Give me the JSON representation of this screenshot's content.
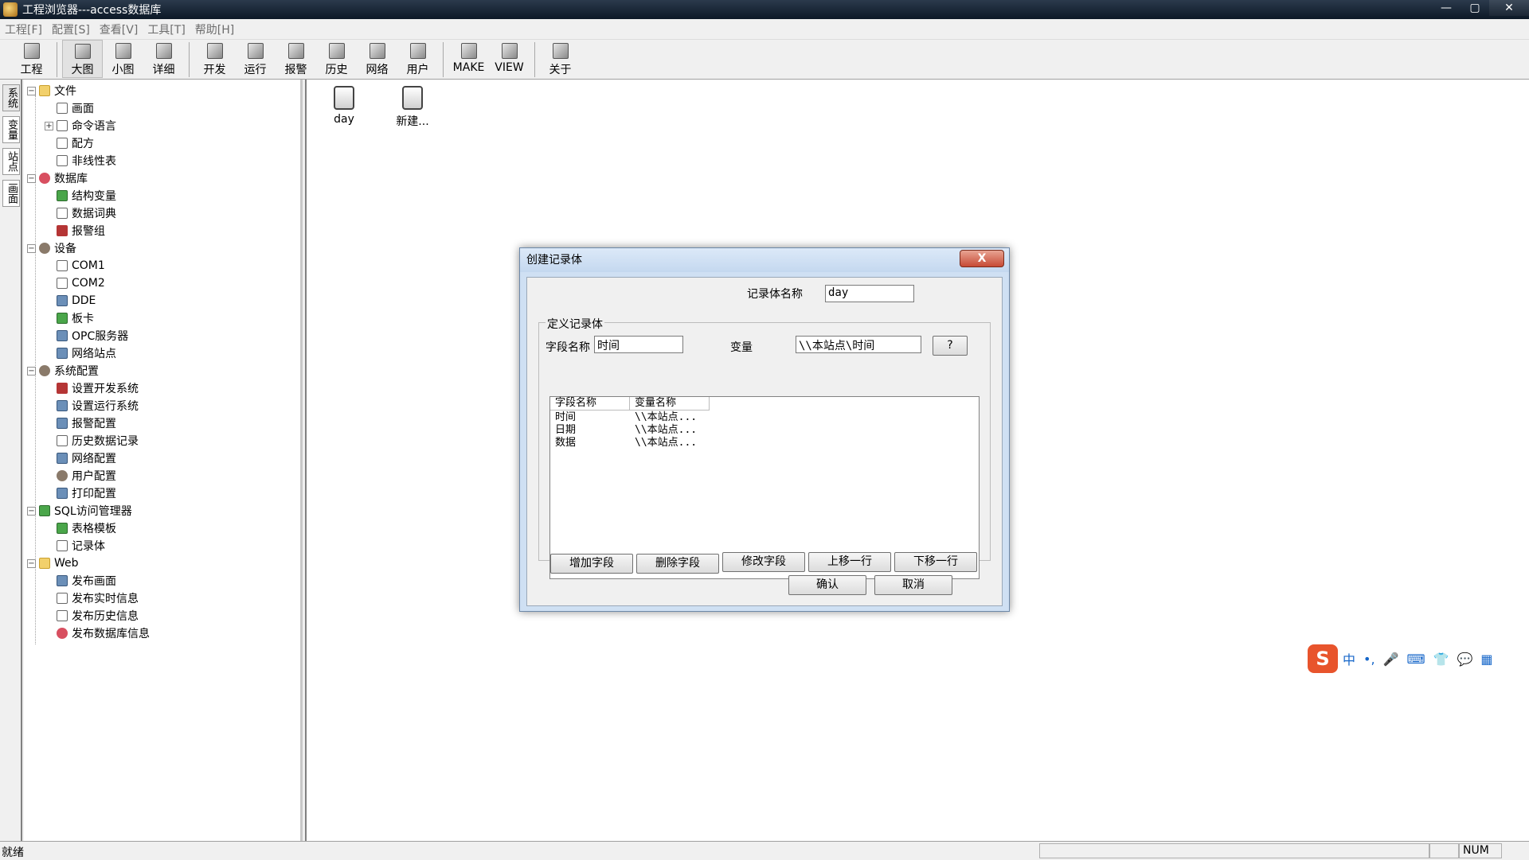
{
  "window": {
    "title": "工程浏览器---access数据库",
    "minimize": "—",
    "maximize": "▢",
    "close": "✕"
  },
  "menubar": [
    "工程[F]",
    "配置[S]",
    "查看[V]",
    "工具[T]",
    "帮助[H]"
  ],
  "toolbar": [
    "工程",
    "大图",
    "小图",
    "详细",
    "开发",
    "运行",
    "报警",
    "历史",
    "网络",
    "用户",
    "MAKE",
    "VIEW",
    "关于"
  ],
  "sidetabs": [
    "系统",
    "变量",
    "站点",
    "画面"
  ],
  "tree": [
    {
      "label": "文件",
      "level": 0,
      "exp": "−",
      "icon": "folder"
    },
    {
      "label": "画面",
      "level": 1,
      "icon": "doc"
    },
    {
      "label": "命令语言",
      "level": 1,
      "exp": "+",
      "icon": "doc"
    },
    {
      "label": "配方",
      "level": 1,
      "icon": "doc"
    },
    {
      "label": "非线性表",
      "level": 1,
      "icon": "doc"
    },
    {
      "label": "数据库",
      "level": 0,
      "exp": "−",
      "icon": "db"
    },
    {
      "label": "结构变量",
      "level": 1,
      "icon": "green"
    },
    {
      "label": "数据词典",
      "level": 1,
      "icon": "doc"
    },
    {
      "label": "报警组",
      "level": 1,
      "icon": "red"
    },
    {
      "label": "设备",
      "level": 0,
      "exp": "−",
      "icon": "gear"
    },
    {
      "label": "COM1",
      "level": 1,
      "icon": "doc"
    },
    {
      "label": "COM2",
      "level": 1,
      "icon": "doc"
    },
    {
      "label": "DDE",
      "level": 1,
      "icon": "pc"
    },
    {
      "label": "板卡",
      "level": 1,
      "icon": "green"
    },
    {
      "label": "OPC服务器",
      "level": 1,
      "icon": "pc"
    },
    {
      "label": "网络站点",
      "level": 1,
      "icon": "pc"
    },
    {
      "label": "系统配置",
      "level": 0,
      "exp": "−",
      "icon": "gear"
    },
    {
      "label": "设置开发系统",
      "level": 1,
      "icon": "red"
    },
    {
      "label": "设置运行系统",
      "level": 1,
      "icon": "pc"
    },
    {
      "label": "报警配置",
      "level": 1,
      "icon": "pc"
    },
    {
      "label": "历史数据记录",
      "level": 1,
      "icon": "doc"
    },
    {
      "label": "网络配置",
      "level": 1,
      "icon": "pc"
    },
    {
      "label": "用户配置",
      "level": 1,
      "icon": "gear"
    },
    {
      "label": "打印配置",
      "level": 1,
      "icon": "pc"
    },
    {
      "label": "SQL访问管理器",
      "level": 0,
      "exp": "−",
      "icon": "green"
    },
    {
      "label": "表格模板",
      "level": 1,
      "icon": "green"
    },
    {
      "label": "记录体",
      "level": 1,
      "icon": "doc"
    },
    {
      "label": "Web",
      "level": 0,
      "exp": "−",
      "icon": "folder"
    },
    {
      "label": "发布画面",
      "level": 1,
      "icon": "pc"
    },
    {
      "label": "发布实时信息",
      "level": 1,
      "icon": "doc"
    },
    {
      "label": "发布历史信息",
      "level": 1,
      "icon": "doc"
    },
    {
      "label": "发布数据库信息",
      "level": 1,
      "icon": "db"
    }
  ],
  "content": {
    "items": [
      "day",
      "新建..."
    ]
  },
  "dialog": {
    "title": "创建记录体",
    "close": "X",
    "name_label": "记录体名称",
    "name_value": "day",
    "group_title": "定义记录体",
    "field_label": "字段名称",
    "field_value": "时间",
    "var_label": "变量",
    "var_value": "\\\\本站点\\时间",
    "browse": "?",
    "columns": [
      "字段名称",
      "变量名称"
    ],
    "rows": [
      [
        "时间",
        "\\\\本站点..."
      ],
      [
        "日期",
        "\\\\本站点..."
      ],
      [
        "数据",
        "\\\\本站点..."
      ]
    ],
    "buttons": [
      "增加字段",
      "删除字段",
      "修改字段",
      "上移一行",
      "下移一行"
    ],
    "ok": "确认",
    "cancel": "取消"
  },
  "ime": {
    "logo": "S",
    "items": [
      "中",
      "•,",
      "🎤",
      "⌨",
      "👕",
      "💬",
      "▦"
    ]
  },
  "status": {
    "text": "就绪",
    "num": "NUM"
  }
}
